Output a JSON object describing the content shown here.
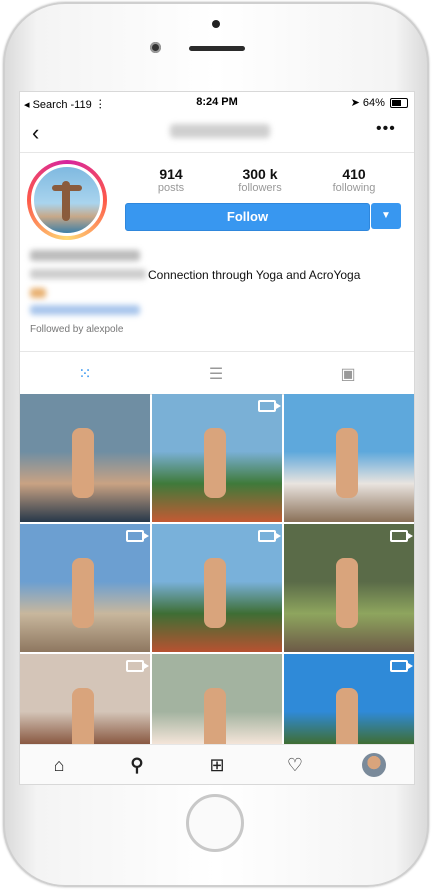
{
  "status_bar": {
    "carrier": "◂ Search",
    "signal": "-119",
    "time": "8:24 PM",
    "battery": "64%"
  },
  "nav": {
    "back_icon": "chevron-left-icon",
    "more_icon": "more-horizontal-icon"
  },
  "stats": {
    "posts_count": "914",
    "posts_label": "posts",
    "followers_count": "300 k",
    "followers_label": "followers",
    "following_count": "410",
    "following_label": "following"
  },
  "follow_button": {
    "label": "Follow"
  },
  "bio": {
    "tagline": "Connection through Yoga and AcroYoga",
    "followed_by": "Followed by alexpole"
  },
  "tabs": [
    "grid-icon",
    "list-icon",
    "tagged-icon"
  ],
  "grid_items": [
    {
      "name": "post-1",
      "video": false,
      "colors": [
        "#6f8ea3",
        "#c9a283",
        "#27384a"
      ]
    },
    {
      "name": "post-2",
      "video": true,
      "colors": [
        "#7ab0d6",
        "#3f7a3a",
        "#c45a34"
      ]
    },
    {
      "name": "post-3",
      "video": false,
      "colors": [
        "#5ea8dc",
        "#e9e4df",
        "#8a7058"
      ]
    },
    {
      "name": "post-4",
      "video": true,
      "colors": [
        "#6c9fd1",
        "#c8b79d",
        "#8e7760"
      ]
    },
    {
      "name": "post-5",
      "video": true,
      "colors": [
        "#79b1da",
        "#3e6e34",
        "#b85231"
      ]
    },
    {
      "name": "post-6",
      "video": true,
      "colors": [
        "#5a6b48",
        "#8ea55e",
        "#6d5a47"
      ]
    },
    {
      "name": "post-7",
      "video": true,
      "colors": [
        "#d4c5b8",
        "#8a5a43",
        "#9c2a2a"
      ]
    },
    {
      "name": "post-8",
      "video": false,
      "colors": [
        "#a3b3a0",
        "#f3e4d8",
        "#e08a76"
      ]
    },
    {
      "name": "post-9",
      "video": true,
      "colors": [
        "#2f8ad8",
        "#3f6e35",
        "#f1d6c0"
      ]
    }
  ],
  "bottom_nav": [
    "home-icon",
    "search-icon",
    "add-post-icon",
    "heart-icon",
    "profile-avatar"
  ]
}
